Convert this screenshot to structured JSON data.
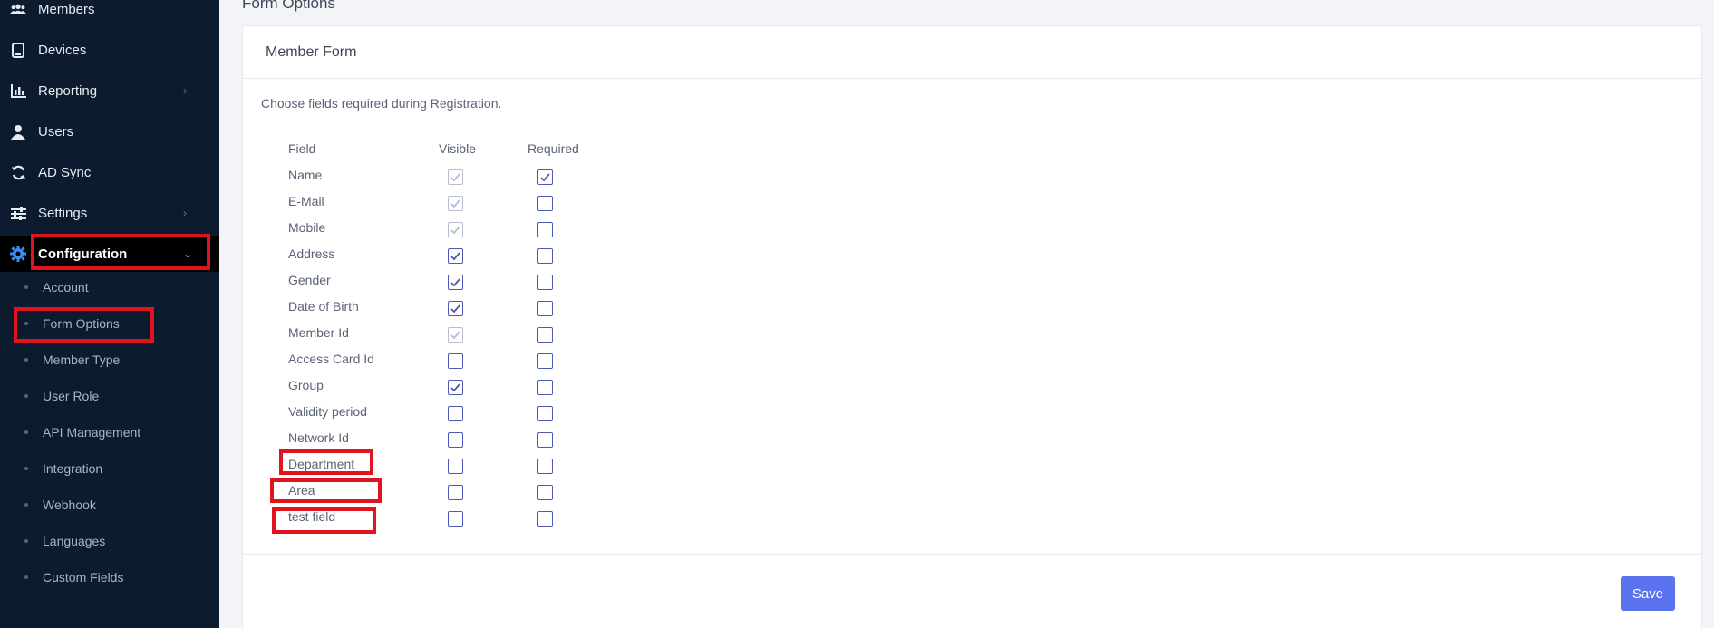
{
  "sidebar": {
    "items": [
      {
        "label": "Members",
        "icon": "members-icon",
        "has_chevron": false
      },
      {
        "label": "Devices",
        "icon": "device-icon",
        "has_chevron": false
      },
      {
        "label": "Reporting",
        "icon": "chart-icon",
        "has_chevron": true
      },
      {
        "label": "Users",
        "icon": "user-icon",
        "has_chevron": false
      },
      {
        "label": "AD Sync",
        "icon": "sync-icon",
        "has_chevron": false
      },
      {
        "label": "Settings",
        "icon": "sliders-icon",
        "has_chevron": true
      },
      {
        "label": "Configuration",
        "icon": "gear-icon",
        "has_chevron": true,
        "active": true
      }
    ],
    "config_sub_items": [
      "Account",
      "Form Options",
      "Member Type",
      "User Role",
      "API Management",
      "Integration",
      "Webhook",
      "Languages",
      "Custom Fields"
    ]
  },
  "page": {
    "title": "Form Options"
  },
  "card": {
    "title": "Member Form",
    "description": "Choose fields required during Registration.",
    "columns": [
      "Field",
      "Visible",
      "Required"
    ],
    "rows": [
      {
        "field": "Name",
        "visible": true,
        "visible_disabled": true,
        "required": true
      },
      {
        "field": "E-Mail",
        "visible": true,
        "visible_disabled": true,
        "required": false
      },
      {
        "field": "Mobile",
        "visible": true,
        "visible_disabled": true,
        "required": false
      },
      {
        "field": "Address",
        "visible": true,
        "visible_disabled": false,
        "required": false
      },
      {
        "field": "Gender",
        "visible": true,
        "visible_disabled": false,
        "required": false
      },
      {
        "field": "Date of Birth",
        "visible": true,
        "visible_disabled": false,
        "required": false
      },
      {
        "field": "Member Id",
        "visible": true,
        "visible_disabled": true,
        "required": false
      },
      {
        "field": "Access Card Id",
        "visible": false,
        "visible_disabled": false,
        "required": false
      },
      {
        "field": "Group",
        "visible": true,
        "visible_disabled": false,
        "required": false
      },
      {
        "field": "Validity period",
        "visible": false,
        "visible_disabled": false,
        "required": false
      },
      {
        "field": "Network Id",
        "visible": false,
        "visible_disabled": false,
        "required": false
      },
      {
        "field": "Department",
        "visible": false,
        "visible_disabled": false,
        "required": false
      },
      {
        "field": "Area",
        "visible": false,
        "visible_disabled": false,
        "required": false
      },
      {
        "field": "test field",
        "visible": false,
        "visible_disabled": false,
        "required": false
      }
    ],
    "save_label": "Save"
  },
  "colors": {
    "sidebar_bg": "#0c1b2e",
    "accent": "#5b73ee",
    "checkbox": "#4e58b5",
    "highlight": "#e0141e"
  }
}
